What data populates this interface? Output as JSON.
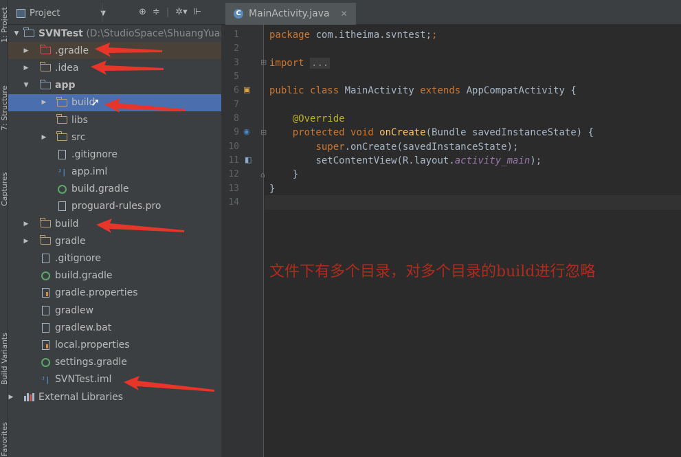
{
  "toolstrip": {
    "tabs": [
      "1: Project",
      "7: Structure",
      "Captures",
      "Build Variants",
      "Favorites"
    ]
  },
  "project_panel": {
    "title": "Project",
    "toolbar_icons": [
      "target-icon",
      "collapse-icon",
      "gear-icon",
      "hide-icon"
    ],
    "tree": [
      {
        "label": "SVNTest",
        "suffix": "(D:\\StudioSpace\\ShuangYuan",
        "icon": "module-folder",
        "bold": true
      },
      {
        "label": ".gradle",
        "icon": "folder-red"
      },
      {
        "label": ".idea",
        "icon": "folder"
      },
      {
        "label": "app",
        "icon": "module-folder",
        "bold": true
      },
      {
        "label": "build",
        "icon": "folder"
      },
      {
        "label": "libs",
        "icon": "folder"
      },
      {
        "label": "src",
        "icon": "folder"
      },
      {
        "label": ".gitignore",
        "icon": "file"
      },
      {
        "label": "app.iml",
        "icon": "iml"
      },
      {
        "label": "build.gradle",
        "icon": "gradle"
      },
      {
        "label": "proguard-rules.pro",
        "icon": "file"
      },
      {
        "label": "build",
        "icon": "folder"
      },
      {
        "label": "gradle",
        "icon": "folder"
      },
      {
        "label": ".gitignore",
        "icon": "file"
      },
      {
        "label": "build.gradle",
        "icon": "gradle"
      },
      {
        "label": "gradle.properties",
        "icon": "properties"
      },
      {
        "label": "gradlew",
        "icon": "file"
      },
      {
        "label": "gradlew.bat",
        "icon": "file"
      },
      {
        "label": "local.properties",
        "icon": "properties"
      },
      {
        "label": "settings.gradle",
        "icon": "gradle"
      },
      {
        "label": "SVNTest.iml",
        "icon": "iml"
      },
      {
        "label": "External Libraries",
        "icon": "libraries"
      }
    ]
  },
  "editor": {
    "tab_label": "MainActivity.java",
    "line_numbers": [
      "1",
      "2",
      "3",
      "5",
      "6",
      "7",
      "8",
      "9",
      "10",
      "11",
      "12",
      "13",
      "14"
    ],
    "code": {
      "l1_kw": "package",
      "l1_rest": " com.itheima.svntest;",
      "l3_kw": "import",
      "l3_fold": "...",
      "l6_kw1": "public",
      "l6_kw2": "class",
      "l6_name": " MainActivity ",
      "l6_kw3": "extends",
      "l6_rest": " AppCompatActivity {",
      "l8_ann": "@Override",
      "l9_kw1": "protected",
      "l9_kw2": "void",
      "l9_fn": "onCreate",
      "l9_rest": "(Bundle savedInstanceState) {",
      "l10_kw": "super",
      "l10_rest": ".onCreate(savedInstanceState);",
      "l11_pre": "setContentView(R.layout.",
      "l11_it": "activity_main",
      "l11_post": ");",
      "l12": "}",
      "l13": "}"
    }
  },
  "annotation": {
    "text": "文件下有多个目录，对多个目录的build进行忽略",
    "color": "#b02a1e"
  },
  "colors": {
    "selection": "#4b6eaf",
    "keyword": "#cc7832",
    "annotation": "#bbb529",
    "function": "#ffc66d",
    "arrow": "#e8352a"
  }
}
